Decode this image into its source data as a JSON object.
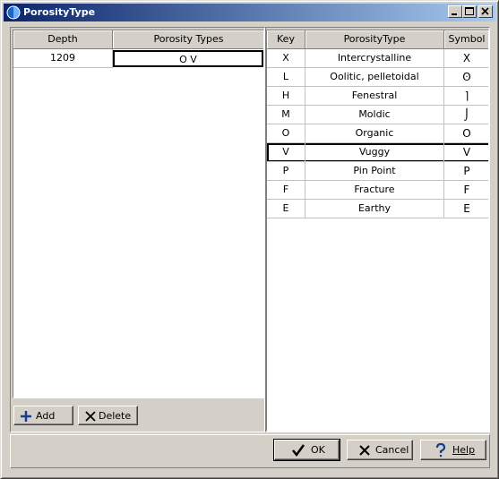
{
  "window": {
    "title": "PorosityType"
  },
  "left_table": {
    "columns": [
      "Depth",
      "Porosity Types"
    ],
    "rows": [
      {
        "depth": "1209",
        "types": "O V"
      }
    ]
  },
  "right_table": {
    "columns": [
      "Key",
      "PorosityType",
      "Symbol"
    ],
    "rows": [
      {
        "key": "X",
        "name": "Intercrystalline",
        "symbol": "X"
      },
      {
        "key": "L",
        "name": "Oolitic, pelletoidal",
        "symbol": "ʘ"
      },
      {
        "key": "H",
        "name": "Fenestral",
        "symbol": "⌉"
      },
      {
        "key": "M",
        "name": "Moldic",
        "symbol": "⌡"
      },
      {
        "key": "O",
        "name": "Organic",
        "symbol": "O"
      },
      {
        "key": "V",
        "name": "Vuggy",
        "symbol": "V"
      },
      {
        "key": "P",
        "name": "Pin Point",
        "symbol": "P"
      },
      {
        "key": "F",
        "name": "Fracture",
        "symbol": "F"
      },
      {
        "key": "E",
        "name": "Earthy",
        "symbol": "E"
      }
    ]
  },
  "buttons": {
    "add": "Add",
    "delete": "Delete",
    "ok": "OK",
    "cancel": "Cancel",
    "help": "Help"
  },
  "icons": {
    "add": "plus-icon",
    "delete": "x-icon",
    "ok": "check-icon",
    "cancel": "x-icon",
    "help": "question-icon"
  },
  "colors": {
    "titlebar_start": "#0a246a",
    "titlebar_end": "#a6caf0",
    "face": "#d4d0c8"
  }
}
